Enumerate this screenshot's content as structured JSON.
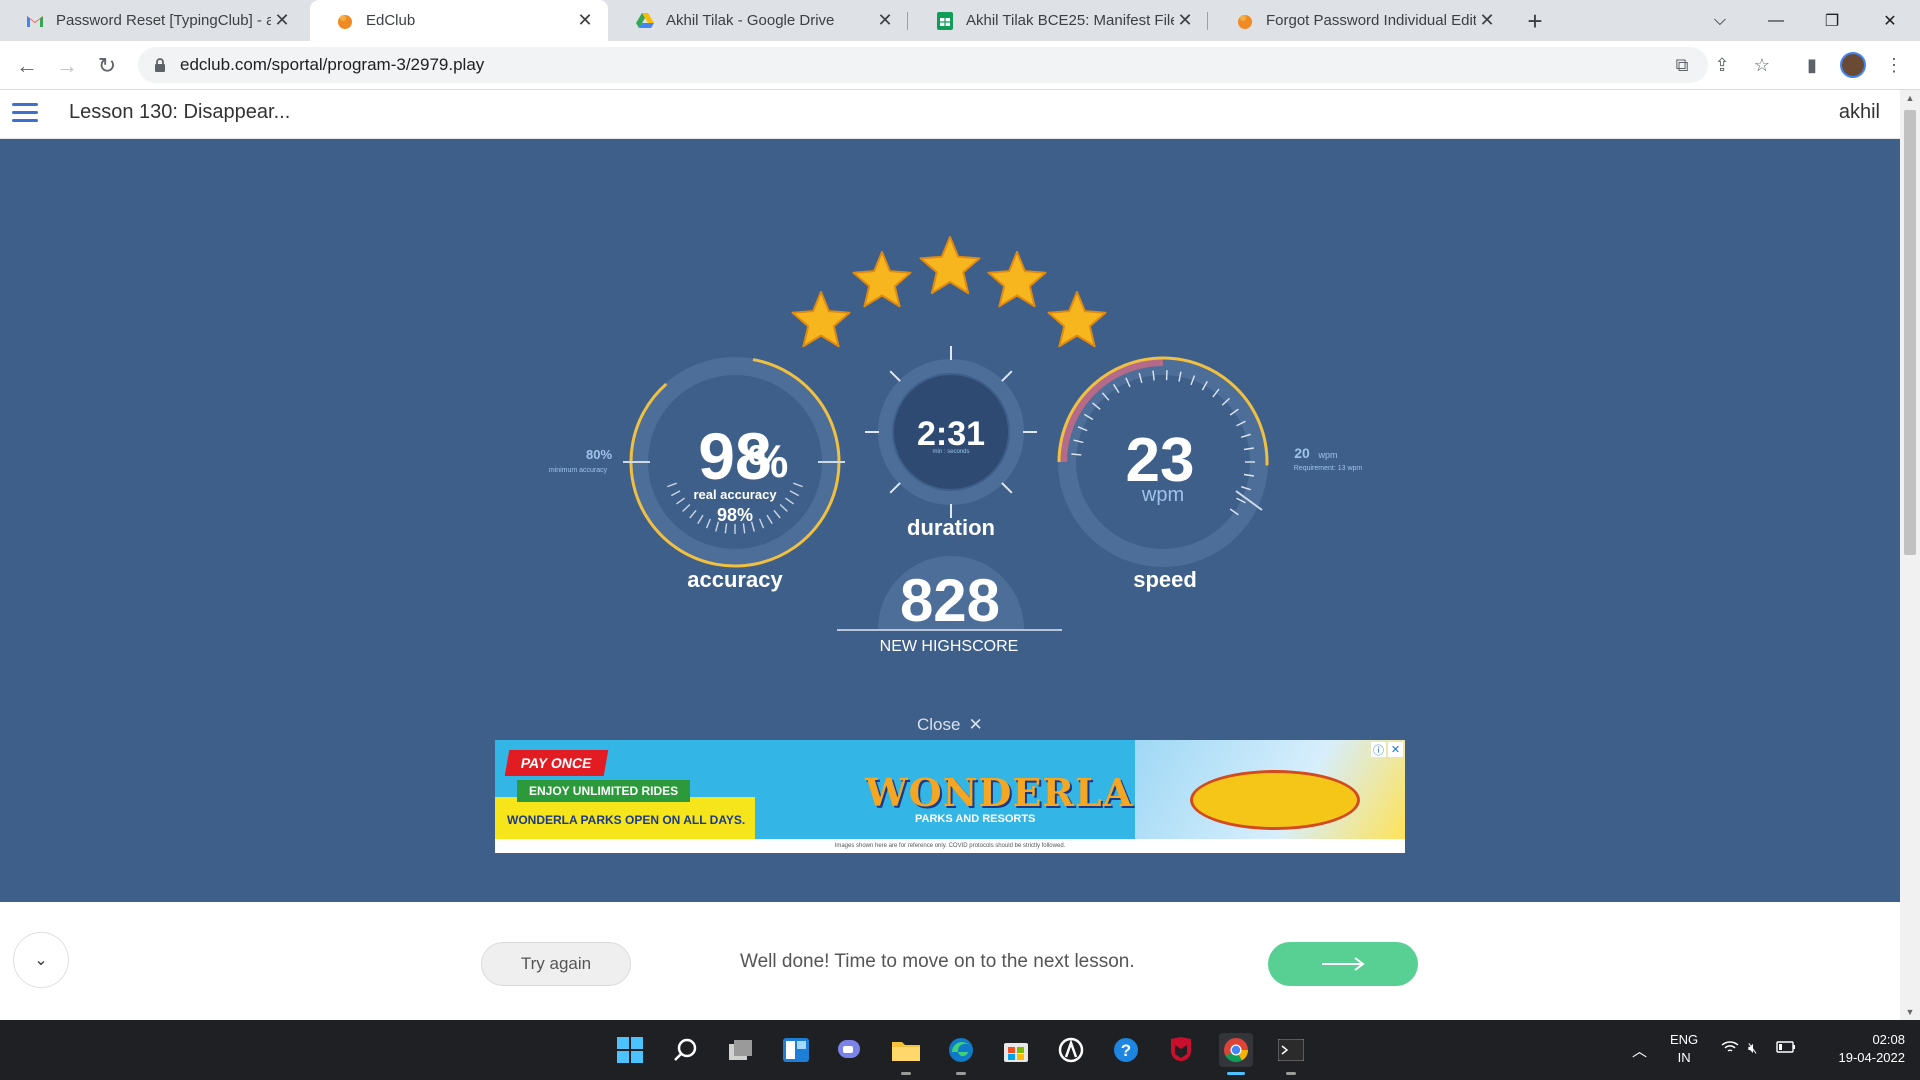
{
  "browser": {
    "tabs": [
      {
        "title": "Password Reset [TypingClub] - ak",
        "favicon": "gmail-icon"
      },
      {
        "title": "EdClub",
        "favicon": "edclub-icon",
        "active": true
      },
      {
        "title": "Akhil Tilak - Google Drive",
        "favicon": "google-drive-icon"
      },
      {
        "title": "Akhil Tilak BCE25: Manifest File -",
        "favicon": "google-sheets-icon"
      },
      {
        "title": "Forgot Password Individual Editio",
        "favicon": "edclub-icon"
      }
    ],
    "url": "edclub.com/sportal/program-3/2979.play"
  },
  "header": {
    "lesson_title": "Lesson 130: Disappear...",
    "user": "akhil"
  },
  "results": {
    "stars": 5,
    "accuracy": {
      "value": "98",
      "unit": "%",
      "real_label": "real accuracy",
      "real_value": "98%",
      "label": "accuracy",
      "min_value": "80%",
      "min_label": "minimum accuracy"
    },
    "duration": {
      "value": "2:31",
      "sub": "min : seconds",
      "label": "duration"
    },
    "speed": {
      "value": "23",
      "unit": "wpm",
      "label": "speed",
      "req_value": "20",
      "req_unit": "wpm",
      "req_label": "Requirement: 13 wpm"
    },
    "score": {
      "value": "828",
      "label": "NEW HIGHSCORE"
    }
  },
  "ad": {
    "close_label": "Close",
    "pay_once": "PAY ONCE",
    "rides": "ENJOY UNLIMITED RIDES",
    "parks_open": "WONDERLA PARKS OPEN ON ALL DAYS.",
    "brand": "WONDERLA",
    "brand_sub": "PARKS AND RESORTS",
    "disclaimer": "Images shown here are for reference only. COVID protocols should be strictly followed."
  },
  "footer": {
    "try_again": "Try again",
    "message": "Well done! Time to move on to the next lesson."
  },
  "taskbar": {
    "lang": "ENG",
    "region": "IN",
    "time": "02:08",
    "date": "19-04-2022"
  },
  "colors": {
    "stage_bg": "#3e5f8a",
    "gauge_gold": "#f0c040",
    "gauge_ring": "#4e6e9a",
    "next_button": "#58cf93"
  }
}
